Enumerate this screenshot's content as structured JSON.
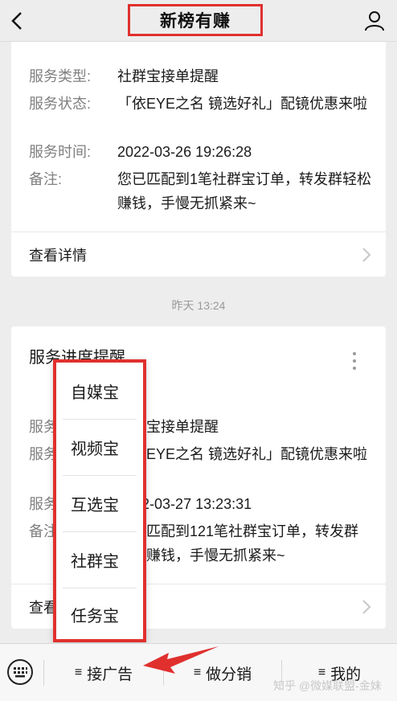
{
  "header": {
    "title": "新榜有赚"
  },
  "card1": {
    "rows": [
      {
        "label": "服务类型:",
        "value": "社群宝接单提醒"
      },
      {
        "label": "服务状态:",
        "value": "「依EYE之名 镜选好礼」配镜优惠来啦"
      },
      {
        "label": "服务时间:",
        "value": "2022-03-26 19:26:28"
      },
      {
        "label": "备注:",
        "value": "您已匹配到1笔社群宝订单，转发群轻松赚钱，手慢无抓紧来~"
      }
    ],
    "detail_label": "查看详情"
  },
  "timestamp": "昨天 13:24",
  "card2": {
    "title": "服务进度提醒",
    "rows": [
      {
        "label": "服务类型:",
        "value": "社群宝接单提醒"
      },
      {
        "label": "服务状态:",
        "value": "「依EYE之名 镜选好礼」配镜优惠来啦"
      },
      {
        "label": "服务时间:",
        "value": "2022-03-27 13:23:31"
      },
      {
        "label": "备注:",
        "value": "您已匹配到121笔社群宝订单，转发群轻松赚钱，手慢无抓紧来~"
      }
    ],
    "detail_label": "查看详情"
  },
  "popup_menu": {
    "items": [
      "自媒宝",
      "视频宝",
      "互选宝",
      "社群宝",
      "任务宝"
    ]
  },
  "bottom_bar": {
    "menus": [
      {
        "label": "接广告"
      },
      {
        "label": "做分销"
      },
      {
        "label": "我的"
      }
    ],
    "menu_prefix": "≡"
  },
  "watermark": "知乎 @微媒联盟-金妹",
  "colors": {
    "highlight": "#e0302e",
    "background": "#ededed"
  }
}
